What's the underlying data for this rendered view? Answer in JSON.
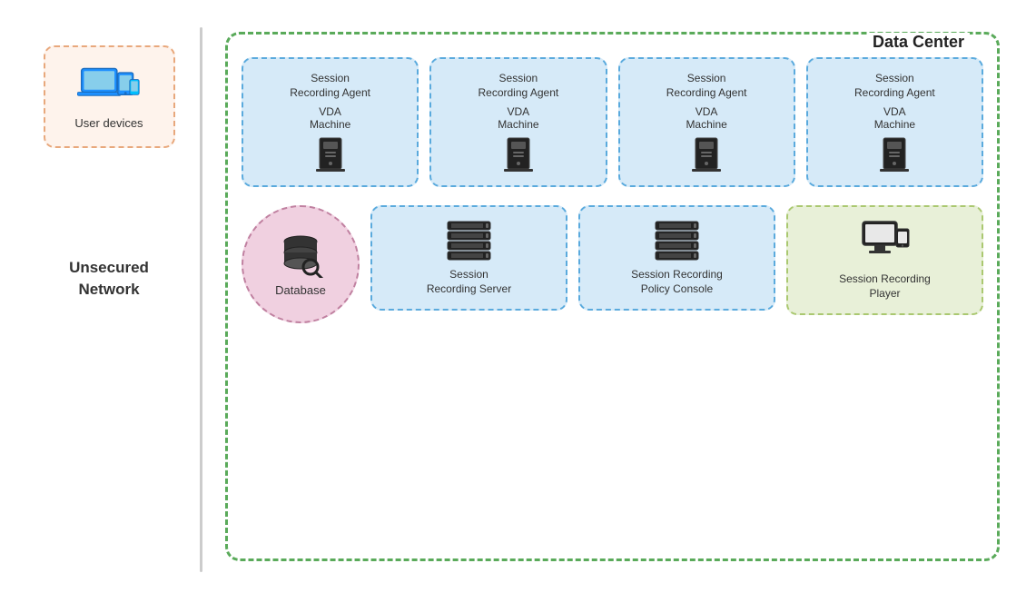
{
  "left": {
    "user_devices_label": "User devices",
    "unsecured_network_label": "Unsecured\nNetwork"
  },
  "data_center": {
    "title": "Data Center",
    "agents": [
      {
        "title": "Session\nRecording Agent",
        "sub": "VDA\nMachine"
      },
      {
        "title": "Session\nRecording Agent",
        "sub": "VDA\nMachine"
      },
      {
        "title": "Session\nRecording Agent",
        "sub": "VDA\nMachine"
      },
      {
        "title": "Session\nRecording Agent",
        "sub": "VDA\nMachine"
      }
    ],
    "database_label": "Database",
    "server_label": "Session\nRecording Server",
    "policy_label": "Session Recording\nPolicy Console",
    "player_label": "Session Recording\nPlayer"
  },
  "icons": {
    "tower": "🖥",
    "database": "🗄",
    "server_rack": "🖧",
    "monitor": "🖥"
  }
}
